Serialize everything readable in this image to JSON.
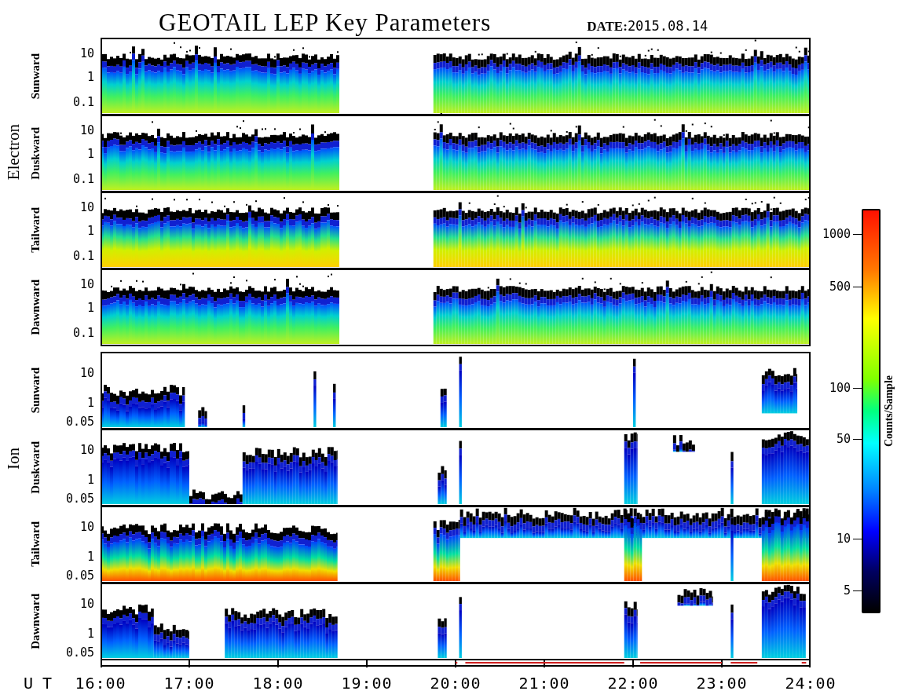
{
  "title": "GEOTAIL LEP Key Parameters",
  "date": {
    "label": "DATE:",
    "value": "2015.08.14"
  },
  "groups": [
    {
      "name": "Electron",
      "kind": "electron",
      "panels": [
        {
          "label": "Sunward",
          "yticks": [
            "10",
            "1",
            "0.1"
          ]
        },
        {
          "label": "Duskward",
          "yticks": [
            "10",
            "1",
            "0.1"
          ]
        },
        {
          "label": "Tailward",
          "yticks": [
            "10",
            "1",
            "0.1"
          ]
        },
        {
          "label": "Dawnward",
          "yticks": [
            "10",
            "1",
            "0.1"
          ]
        }
      ]
    },
    {
      "name": "Ion",
      "kind": "ion",
      "panels": [
        {
          "label": "Sunward",
          "yticks": [
            "10",
            "1",
            "0.05"
          ]
        },
        {
          "label": "Duskward",
          "yticks": [
            "10",
            "1",
            "0.05"
          ]
        },
        {
          "label": "Tailward",
          "yticks": [
            "10",
            "1",
            "0.05"
          ]
        },
        {
          "label": "Dawnward",
          "yticks": [
            "10",
            "1",
            "0.05"
          ]
        }
      ]
    }
  ],
  "x_axis": {
    "label": "U T",
    "ticks": [
      "16:00",
      "17:00",
      "18:00",
      "19:00",
      "20:00",
      "21:00",
      "22:00",
      "23:00",
      "24:00"
    ]
  },
  "colorbar": {
    "title": "Counts/Sample",
    "ticks": [
      "1000",
      "500",
      "100",
      "50",
      "10",
      "5"
    ]
  }
}
